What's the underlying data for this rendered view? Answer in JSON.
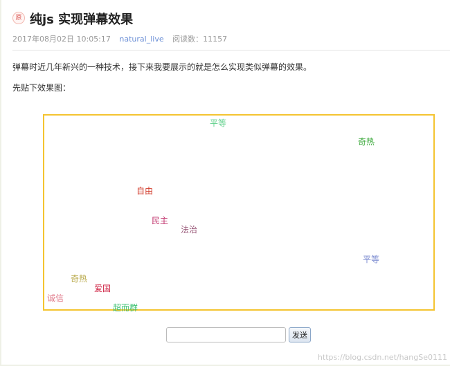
{
  "article": {
    "badge": "原",
    "title": "纯js 实现弹幕效果",
    "date": "2017年08月02日 10:05:17",
    "author": "natural_live",
    "reads_label": "阅读数：",
    "reads_count": "11157",
    "paragraph_1": "弹幕时近几年新兴的一种技术，接下来我要展示的就是怎么实现类似弹幕的效果。",
    "paragraph_2": "先贴下效果图："
  },
  "danmaku": {
    "border_color": "#f4c430",
    "bullets": [
      {
        "text": "平等",
        "color": "#5fd08a"
      },
      {
        "text": "奇热",
        "color": "#3aa83a"
      },
      {
        "text": "自由",
        "color": "#d23a2a"
      },
      {
        "text": "民主",
        "color": "#c0306a"
      },
      {
        "text": "法治",
        "color": "#9a5a7a"
      },
      {
        "text": "平等",
        "color": "#7a8ad0"
      },
      {
        "text": "奇热",
        "color": "#b8a848"
      },
      {
        "text": "爱国",
        "color": "#d02848"
      },
      {
        "text": "诚信",
        "color": "#e07a8a"
      },
      {
        "text": "超而群",
        "color": "#3ac070"
      }
    ]
  },
  "form": {
    "input_value": "",
    "send_label": "发送"
  },
  "watermark": "https://blog.csdn.net/hangSe0111"
}
